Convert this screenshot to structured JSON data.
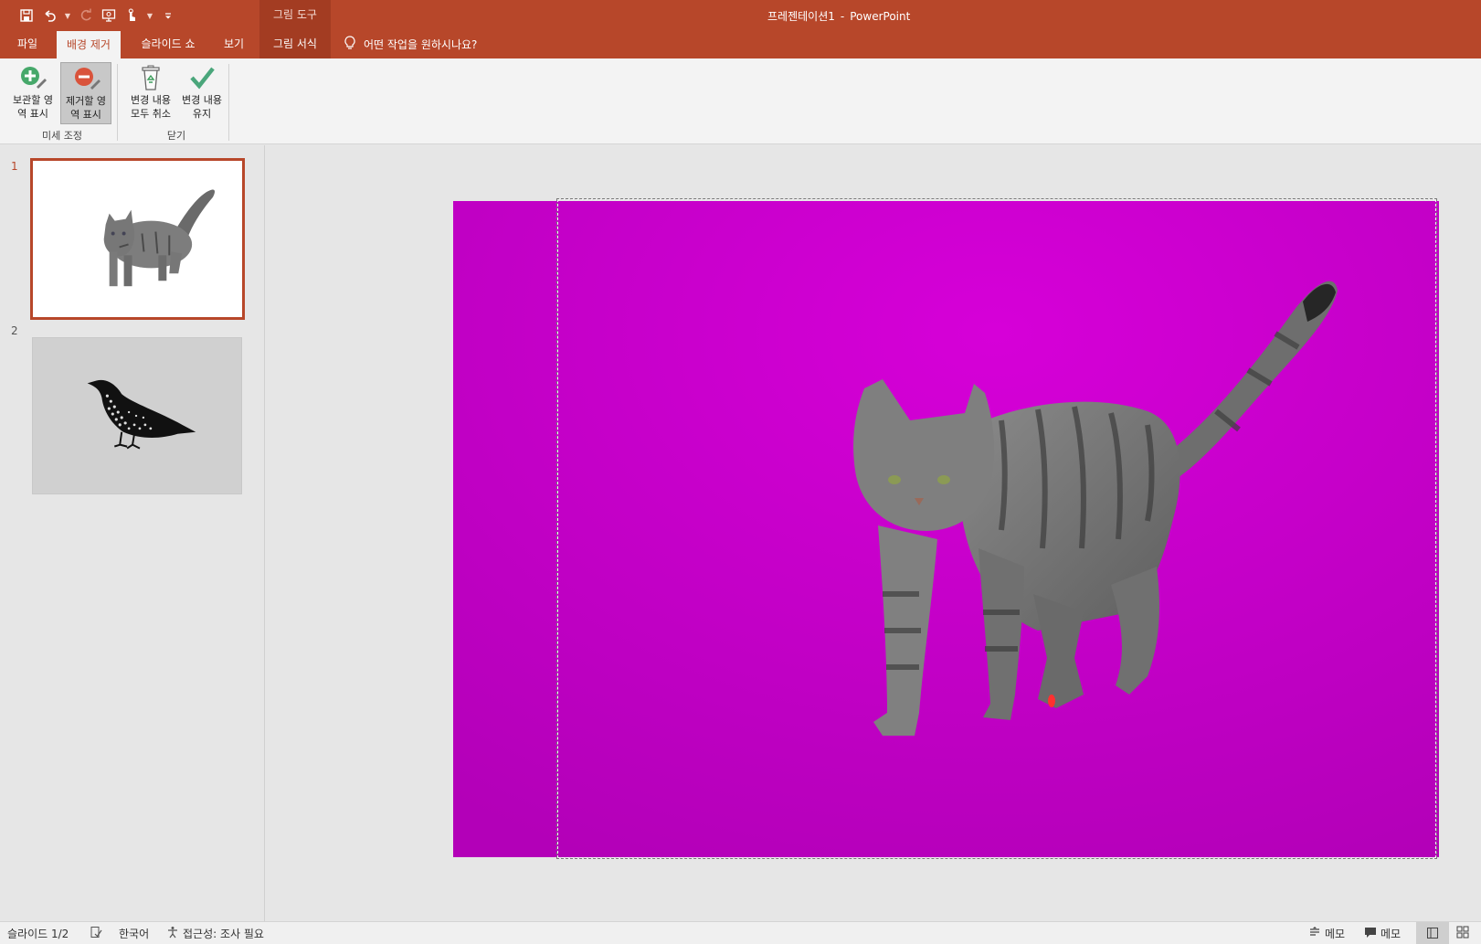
{
  "window": {
    "doc_title": "프레젠테이션1",
    "separator": "-",
    "app_name": "PowerPoint",
    "context_group": "그림 도구"
  },
  "qat": {
    "icons": [
      "save-icon",
      "undo-icon",
      "redo-icon",
      "presentation-icon",
      "touch-mode-icon",
      "customize-icon"
    ]
  },
  "tabs": {
    "file": "파일",
    "background_removal": "배경 제거",
    "slideshow": "슬라이드 쇼",
    "view": "보기",
    "picture_format": "그림 서식"
  },
  "tell_me": "어떤 작업을 원하시나요?",
  "ribbon": {
    "refine_group": "미세 조정",
    "close_group": "닫기",
    "mark_keep": "보관할 영역 표시",
    "mark_remove": "제거할 영역 표시",
    "discard_all": "변경 내용 모두 취소",
    "keep_changes": "변경 내용 유지"
  },
  "thumbnails": [
    {
      "number": "1"
    },
    {
      "number": "2"
    }
  ],
  "status": {
    "slide": "슬라이드 1/2",
    "language": "한국어",
    "accessibility": "접근성: 조사 필요",
    "notes": "메모",
    "comments": "메모"
  },
  "colors": {
    "accent": "#b7472a",
    "remove_mask": "#c000c4"
  }
}
